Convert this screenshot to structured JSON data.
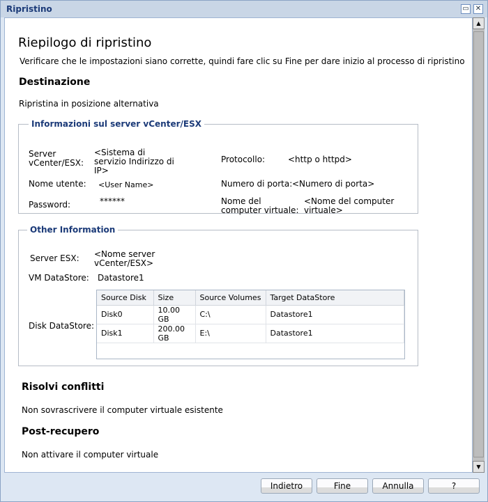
{
  "window": {
    "title": "Ripristino"
  },
  "page": {
    "title": "Riepilogo di ripristino",
    "subtitle": "Verificare che le impostazioni siano corrette, quindi fare clic su Fine per dare inizio al processo di ripristino"
  },
  "destination": {
    "heading": "Destinazione",
    "value": "Ripristina in posizione alternativa"
  },
  "vcenter": {
    "legend": "Informazioni sul server vCenter/ESX",
    "server_label": "Server vCenter/ESX:",
    "server_value": "<Sistema di servizio Indirizzo di IP>",
    "protocol_label": "Protocollo:",
    "protocol_value": "<http o httpd>",
    "user_label": "Nome utente:",
    "user_value": "<User Name>",
    "port_label": "Numero di porta:",
    "port_value": "<Numero di porta>",
    "password_label": "Password:",
    "password_value": "******",
    "vmname_label": "Nome del computer virtuale:",
    "vmname_value": "<Nome del computer virtuale>"
  },
  "other": {
    "legend": "Other Information",
    "esx_label": "Server ESX:",
    "esx_value": "<Nome server vCenter/ESX>",
    "datastore_label": "VM DataStore:",
    "datastore_value": "Datastore1",
    "disk_label": "Disk DataStore:",
    "columns": [
      "Source Disk",
      "Size",
      "Source Volumes",
      "Target DataStore"
    ],
    "rows": [
      [
        "Disk0",
        "10.00 GB",
        "C:\\",
        "Datastore1"
      ],
      [
        "Disk1",
        "200.00 GB",
        "E:\\",
        "Datastore1"
      ]
    ]
  },
  "conflicts": {
    "heading": "Risolvi conflitti",
    "value": "Non sovrascrivere il computer virtuale esistente"
  },
  "post": {
    "heading": "Post-recupero",
    "value": "Non attivare il computer virtuale"
  },
  "buttons": {
    "back": "Indietro",
    "finish": "Fine",
    "cancel": "Annulla",
    "help": "?"
  }
}
